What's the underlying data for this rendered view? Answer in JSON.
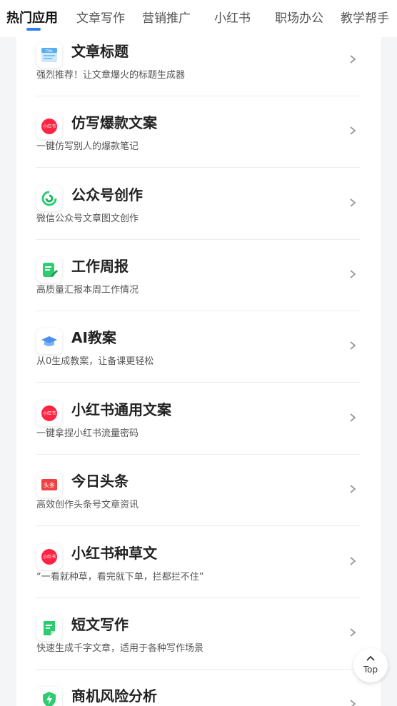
{
  "tabs": [
    {
      "label": "热门应用",
      "active": true
    },
    {
      "label": "文章写作"
    },
    {
      "label": "营销推广"
    },
    {
      "label": "小红书"
    },
    {
      "label": "职场办公"
    },
    {
      "label": "教学帮手"
    }
  ],
  "items": [
    {
      "title": "文章标题",
      "desc": "强烈推荐！让文章爆火的标题生成器",
      "icon": "title-doc-icon"
    },
    {
      "title": "仿写爆款文案",
      "desc": "一键仿写别人的爆款笔记",
      "icon": "xiaohongshu-icon",
      "icon_text": "小红书"
    },
    {
      "title": "公众号创作",
      "desc": "微信公众号文章图文创作",
      "icon": "wechat-official-icon"
    },
    {
      "title": "工作周报",
      "desc": "高质量汇报本周工作情况",
      "icon": "report-edit-icon"
    },
    {
      "title": "AI教案",
      "desc": "从0生成教案，让备课更轻松",
      "icon": "graduation-cap-icon"
    },
    {
      "title": "小红书通用文案",
      "desc": "一键拿捏小红书流量密码",
      "icon": "xiaohongshu-icon",
      "icon_text": "小红书"
    },
    {
      "title": "今日头条",
      "desc": "高效创作头条号文章资讯",
      "icon": "toutiao-icon",
      "icon_text": "头条"
    },
    {
      "title": "小红书种草文",
      "desc": "“一看就种草，看完就下单，拦都拦不住”",
      "icon": "xiaohongshu-icon",
      "icon_text": "小红书"
    },
    {
      "title": "短文写作",
      "desc": "快速生成千字文章，适用于各种写作场景",
      "icon": "short-doc-icon"
    },
    {
      "title": "商机风险分析",
      "desc": "",
      "icon": "shield-bolt-icon"
    }
  ],
  "top_button": {
    "label": "Top"
  },
  "colors": {
    "accent": "#2f80ed",
    "xhs_red": "#ff2442",
    "toutiao_red": "#f04142",
    "green": "#2ecc71"
  }
}
